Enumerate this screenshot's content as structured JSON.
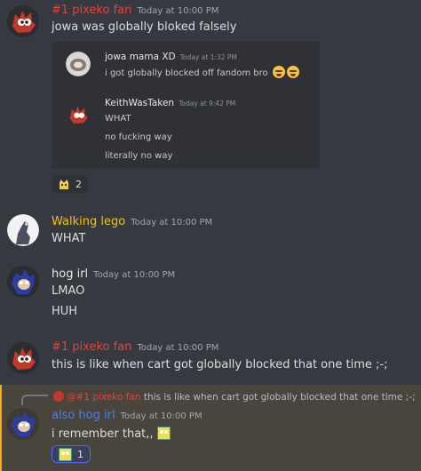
{
  "messages": [
    {
      "username": "#1 pixeko fan",
      "timestamp": "Today at 10:00 PM",
      "lines": [
        "jowa was globally bloked falsely"
      ]
    },
    {
      "username": "Walking lego",
      "timestamp": "Today at 10:00 PM",
      "lines": [
        "WHAT"
      ]
    },
    {
      "username": "hog irl",
      "timestamp": "Today at 10:00 PM",
      "lines": [
        "LMAO",
        "HUH"
      ]
    },
    {
      "username": "#1 pixeko fan",
      "timestamp": "Today at 10:00 PM",
      "lines": [
        "this is like when cart got globally blocked that one time ;-;"
      ]
    },
    {
      "username": "also hog irl",
      "timestamp": "Today at 10:00 PM",
      "lines": [
        "i remember that,,"
      ]
    }
  ],
  "embedded": {
    "msg1": {
      "username": "jowa mama XD",
      "timestamp": "Today at 1:32 PM",
      "text": "i got globally blocked off fandom bro"
    },
    "msg2": {
      "username": "KeithWasTaken",
      "timestamp": "Today at 9:42 PM",
      "lines": [
        "WHAT",
        "no fucking way",
        "literally no way"
      ]
    }
  },
  "reactions": {
    "first": {
      "count": "2"
    },
    "last": {
      "count": "1"
    }
  },
  "reply": {
    "mention": "@#1 pixeko fan",
    "text": "this is like when cart got globally blocked that one time ;-;"
  },
  "colors": {
    "background": "#36393f",
    "pixeko_name": "#e8423a",
    "lego_name": "#f1c40f",
    "hog_name": "#e8e8e8",
    "also_hog_name": "#4d7fe0",
    "mention_highlight": "#49443c"
  }
}
